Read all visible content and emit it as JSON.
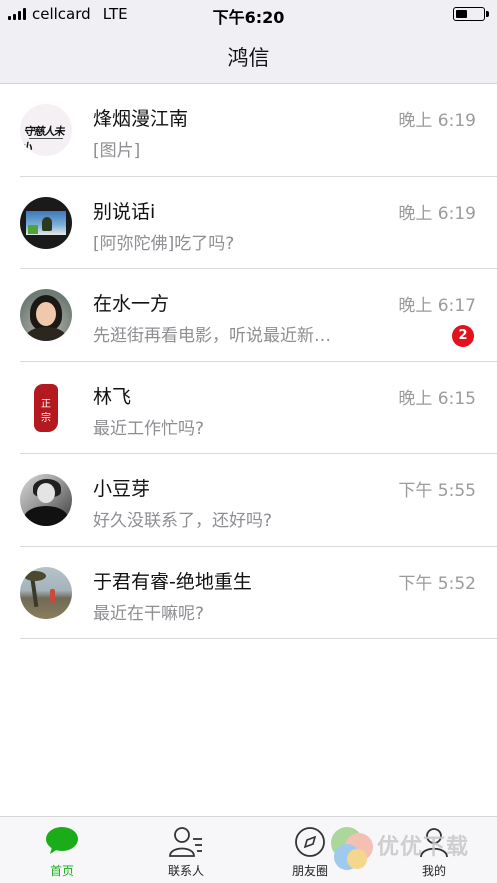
{
  "status_bar": {
    "carrier": "cellcard",
    "network": "LTE",
    "time": "下午6:20"
  },
  "nav": {
    "title": "鸿信"
  },
  "conversations": [
    {
      "name": "烽烟漫江南",
      "preview": "[图片]",
      "time": "晚上 6:19",
      "unread": null,
      "avatar": "calligraphy-avatar"
    },
    {
      "name": "别说话i",
      "preview": "[阿弥陀佛]吃了吗?",
      "time": "晚上 6:19",
      "unread": null,
      "avatar": "screen-photo-avatar"
    },
    {
      "name": "在水一方",
      "preview": "先逛街再看电影，听说最近新…",
      "time": "晚上 6:17",
      "unread": "2",
      "avatar": "woman-photo-avatar"
    },
    {
      "name": "林飞",
      "preview": "最近工作忙吗?",
      "time": "晚上 6:15",
      "unread": null,
      "avatar": "seal-avatar"
    },
    {
      "name": "小豆芽",
      "preview": "好久没联系了，还好吗?",
      "time": "下午 5:55",
      "unread": null,
      "avatar": "bw-photo-avatar"
    },
    {
      "name": "于君有睿-绝地重生",
      "preview": "最近在干嘛呢?",
      "time": "下午 5:52",
      "unread": null,
      "avatar": "beach-photo-avatar"
    }
  ],
  "seal_text": [
    "正",
    "宗"
  ],
  "tabs": [
    {
      "label": "首页",
      "icon": "chat-bubble-icon",
      "active": true
    },
    {
      "label": "联系人",
      "icon": "contacts-icon",
      "active": false
    },
    {
      "label": "朋友圈",
      "icon": "compass-icon",
      "active": false
    },
    {
      "label": "我的",
      "icon": "person-icon",
      "active": false
    }
  ],
  "watermark": "优优下载",
  "colors": {
    "accent_green": "#1aad19",
    "badge_red": "#e0131f",
    "nav_bg": "#efeff4",
    "muted_text": "#8e8e93"
  }
}
